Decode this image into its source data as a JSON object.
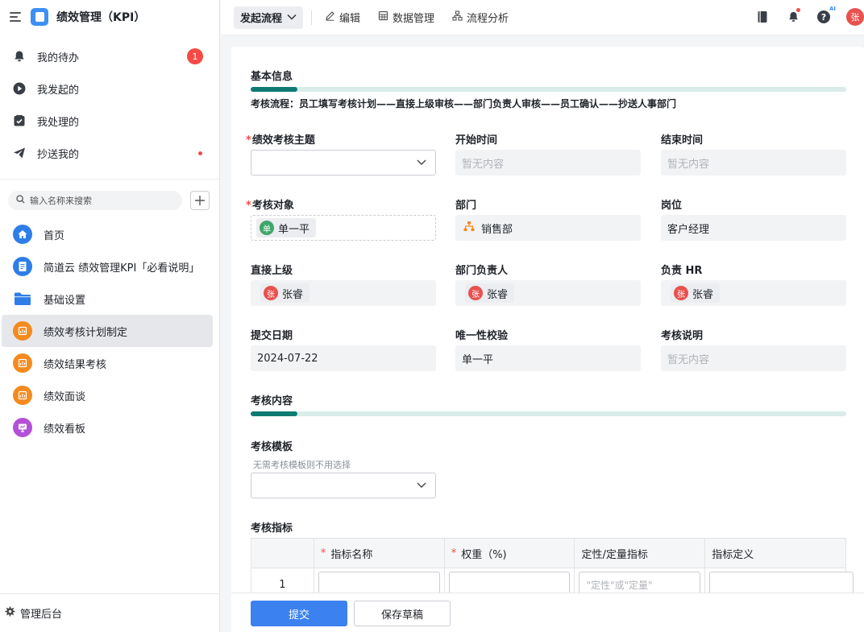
{
  "app": {
    "title": "绩效管理（KPI）"
  },
  "sidebar": {
    "quick": [
      {
        "label": "我的待办",
        "badge": "1"
      },
      {
        "label": "我发起的"
      },
      {
        "label": "我处理的"
      },
      {
        "label": "抄送我的"
      }
    ],
    "search_placeholder": "输入名称来搜索",
    "items": [
      {
        "label": "首页",
        "color": "#2d7ee8",
        "icon": "home-icon"
      },
      {
        "label": "简道云 绩效管理KPI「必看说明」",
        "color": "#2d7ee8",
        "icon": "document-icon"
      },
      {
        "label": "基础设置",
        "color": "#2d7ee8",
        "icon": "folder-icon"
      },
      {
        "label": "绩效考核计划制定",
        "color": "#f58a1f",
        "icon": "form-icon"
      },
      {
        "label": "绩效结果考核",
        "color": "#f58a1f",
        "icon": "form-icon"
      },
      {
        "label": "绩效面谈",
        "color": "#f58a1f",
        "icon": "form-icon"
      },
      {
        "label": "绩效看板",
        "color": "#b44fd8",
        "icon": "dashboard-icon"
      }
    ],
    "footer": "管理后台"
  },
  "toolbar": {
    "primary": "发起流程",
    "edit": "编辑",
    "data": "数据管理",
    "flow": "流程分析",
    "avatar": "张"
  },
  "form": {
    "section1": "基本信息",
    "flow_text": "考核流程：员工填写考核计划——直接上级审核——部门负责人审核——员工确认——抄送人事部门",
    "theme_label": "绩效考核主题",
    "start_label": "开始时间",
    "start_value": "暂无内容",
    "end_label": "结束时间",
    "end_value": "暂无内容",
    "target_label": "考核对象",
    "target_value": "单一平",
    "target_avatar": "单",
    "dept_label": "部门",
    "dept_value": "销售部",
    "post_label": "岗位",
    "post_value": "客户经理",
    "sup_label": "直接上级",
    "sup_value": "张睿",
    "sup_avatar": "张",
    "head_label": "部门负责人",
    "head_value": "张睿",
    "head_avatar": "张",
    "hr_label": "负责 HR",
    "hr_value": "张睿",
    "hr_avatar": "张",
    "date_label": "提交日期",
    "date_value": "2024-07-22",
    "unique_label": "唯一性校验",
    "unique_value": "单一平",
    "note_label": "考核说明",
    "note_value": "暂无内容",
    "section2": "考核内容",
    "template_label": "考核模板",
    "template_hint": "无需考核模板则不用选择",
    "indicator_label": "考核指标",
    "table": {
      "headers": [
        "",
        "指标名称",
        "权重（%)",
        "定性/定量指标",
        "指标定义"
      ],
      "row_index": "1",
      "type_placeholder": "\"定性\"或\"定量\""
    }
  },
  "actions": {
    "submit": "提交",
    "draft": "保存草稿"
  }
}
